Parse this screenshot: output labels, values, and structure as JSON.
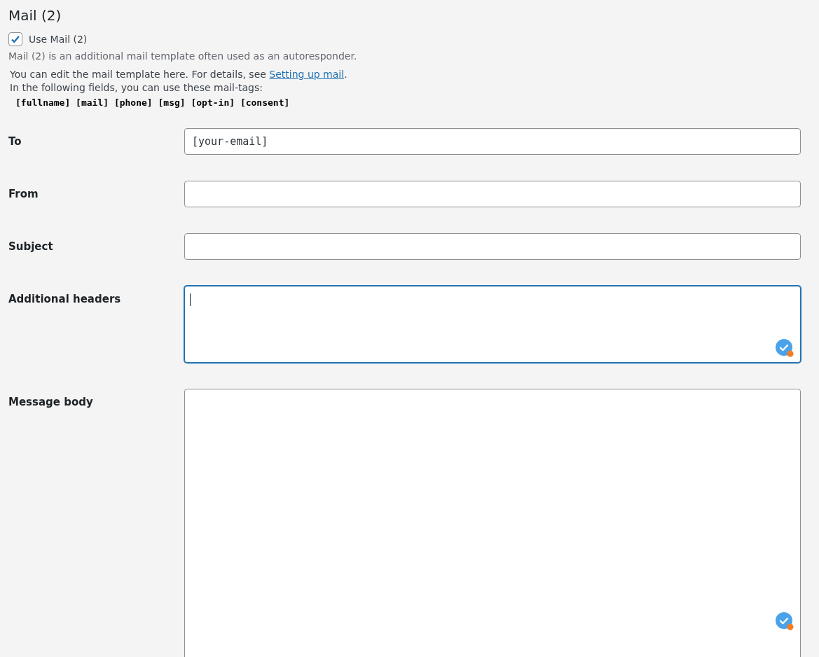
{
  "heading": "Mail (2)",
  "use_mail": {
    "label": "Use Mail (2)",
    "checked": true
  },
  "description": "Mail (2) is an additional mail template often used as an autoresponder.",
  "help": {
    "text": "You can edit the mail template here. For details, see ",
    "link": "Setting up mail",
    "after": "."
  },
  "tags_intro": "In the following fields, you can use these mail-tags:",
  "mail_tags": "[fullname] [mail] [phone] [msg] [opt-in] [consent]",
  "fields": [
    {
      "label": "To",
      "kind": "input",
      "value": "[your-email]",
      "focused": false
    },
    {
      "label": "From",
      "kind": "input",
      "focused": false
    },
    {
      "label": "Subject",
      "kind": "input",
      "focused": false
    },
    {
      "label": "Additional headers",
      "kind": "textarea",
      "focused": true
    },
    {
      "label": "Message body",
      "kind": "body",
      "focused": false
    }
  ]
}
